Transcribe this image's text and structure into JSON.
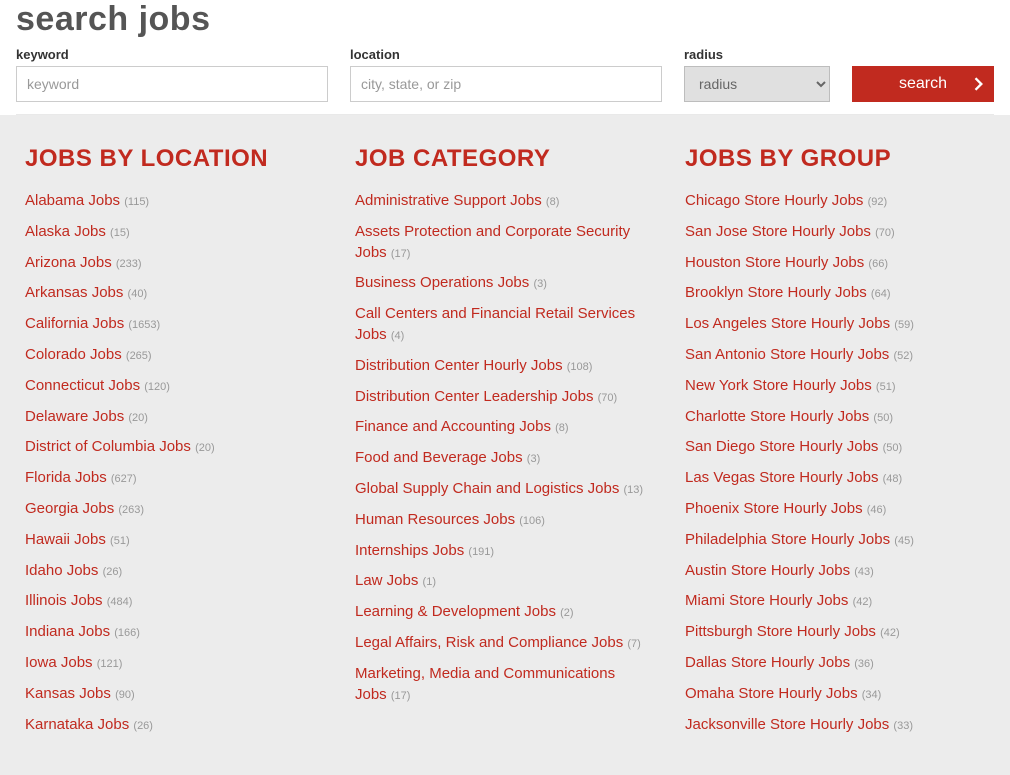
{
  "page_title": "search jobs",
  "search": {
    "keyword_label": "keyword",
    "keyword_placeholder": "keyword",
    "location_label": "location",
    "location_placeholder": "city, state, or zip",
    "radius_label": "radius",
    "radius_placeholder": "radius",
    "button": "search"
  },
  "columns": {
    "location": {
      "title": "JOBS BY LOCATION",
      "items": [
        {
          "label": "Alabama Jobs",
          "count": 115
        },
        {
          "label": "Alaska Jobs",
          "count": 15
        },
        {
          "label": "Arizona Jobs",
          "count": 233
        },
        {
          "label": "Arkansas Jobs",
          "count": 40
        },
        {
          "label": "California Jobs",
          "count": 1653
        },
        {
          "label": "Colorado Jobs",
          "count": 265
        },
        {
          "label": "Connecticut Jobs",
          "count": 120
        },
        {
          "label": "Delaware Jobs",
          "count": 20
        },
        {
          "label": "District of Columbia Jobs",
          "count": 20
        },
        {
          "label": "Florida Jobs",
          "count": 627
        },
        {
          "label": "Georgia Jobs",
          "count": 263
        },
        {
          "label": "Hawaii Jobs",
          "count": 51
        },
        {
          "label": "Idaho Jobs",
          "count": 26
        },
        {
          "label": "Illinois Jobs",
          "count": 484
        },
        {
          "label": "Indiana Jobs",
          "count": 166
        },
        {
          "label": "Iowa Jobs",
          "count": 121
        },
        {
          "label": "Kansas Jobs",
          "count": 90
        },
        {
          "label": "Karnataka Jobs",
          "count": 26
        }
      ]
    },
    "category": {
      "title": "JOB CATEGORY",
      "items": [
        {
          "label": "Administrative Support Jobs",
          "count": 8
        },
        {
          "label": "Assets Protection and Corporate Security Jobs",
          "count": 17
        },
        {
          "label": "Business Operations Jobs",
          "count": 3
        },
        {
          "label": "Call Centers and Financial Retail Services Jobs",
          "count": 4
        },
        {
          "label": "Distribution Center Hourly Jobs",
          "count": 108
        },
        {
          "label": "Distribution Center Leadership Jobs",
          "count": 70
        },
        {
          "label": "Finance and Accounting Jobs",
          "count": 8
        },
        {
          "label": "Food and Beverage Jobs",
          "count": 3
        },
        {
          "label": "Global Supply Chain and Logistics Jobs",
          "count": 13
        },
        {
          "label": "Human Resources Jobs",
          "count": 106
        },
        {
          "label": "Internships Jobs",
          "count": 191
        },
        {
          "label": "Law Jobs",
          "count": 1
        },
        {
          "label": "Learning & Development Jobs",
          "count": 2
        },
        {
          "label": "Legal Affairs, Risk and Compliance Jobs",
          "count": 7
        },
        {
          "label": "Marketing, Media and Communications Jobs",
          "count": 17
        }
      ]
    },
    "group": {
      "title": "JOBS BY GROUP",
      "items": [
        {
          "label": "Chicago Store Hourly Jobs",
          "count": 92
        },
        {
          "label": "San Jose Store Hourly Jobs",
          "count": 70
        },
        {
          "label": "Houston Store Hourly Jobs",
          "count": 66
        },
        {
          "label": "Brooklyn Store Hourly Jobs",
          "count": 64
        },
        {
          "label": "Los Angeles Store Hourly Jobs",
          "count": 59
        },
        {
          "label": "San Antonio Store Hourly Jobs",
          "count": 52
        },
        {
          "label": "New York Store Hourly Jobs",
          "count": 51
        },
        {
          "label": "Charlotte Store Hourly Jobs",
          "count": 50
        },
        {
          "label": "San Diego Store Hourly Jobs",
          "count": 50
        },
        {
          "label": "Las Vegas Store Hourly Jobs",
          "count": 48
        },
        {
          "label": "Phoenix Store Hourly Jobs",
          "count": 46
        },
        {
          "label": "Philadelphia Store Hourly Jobs",
          "count": 45
        },
        {
          "label": "Austin Store Hourly Jobs",
          "count": 43
        },
        {
          "label": "Miami Store Hourly Jobs",
          "count": 42
        },
        {
          "label": "Pittsburgh Store Hourly Jobs",
          "count": 42
        },
        {
          "label": "Dallas Store Hourly Jobs",
          "count": 36
        },
        {
          "label": "Omaha Store Hourly Jobs",
          "count": 34
        },
        {
          "label": "Jacksonville Store Hourly Jobs",
          "count": 33
        }
      ]
    }
  }
}
